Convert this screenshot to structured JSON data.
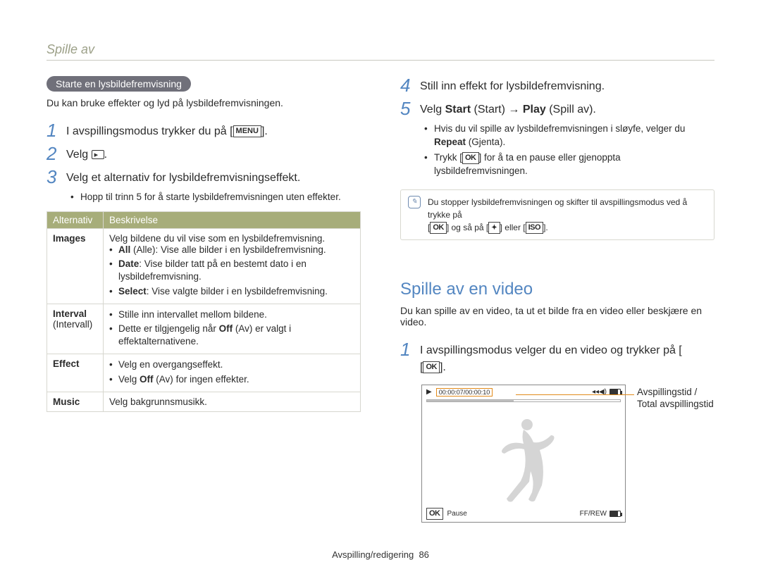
{
  "header": {
    "section": "Spille av"
  },
  "left": {
    "pill": "Starte en lysbildefremvisning",
    "intro": "Du kan bruke effekter og lyd på lysbildefremvisningen.",
    "step1_pre": "I avspillingsmodus trykker du på [",
    "step1_key": "MENU",
    "step1_post": "].",
    "step2": "Velg ",
    "step3": "Velg et alternativ for lysbildefremvisningseffekt.",
    "step3_bullet": "Hopp til trinn 5 for å starte lysbildefremvisningen uten effekter.",
    "table": {
      "h1": "Alternativ",
      "h2": "Beskrivelse",
      "rows": [
        {
          "opt": "Images",
          "desc_intro": "Velg bildene du vil vise som en lysbildefremvisning.",
          "items": [
            {
              "b": "All",
              "paren": "(Alle)",
              "rest": ": Vise alle bilder i en lysbildefremvisning."
            },
            {
              "b": "Date",
              "paren": "",
              "rest": ": Vise bilder tatt på en bestemt dato i en lysbildefremvisning."
            },
            {
              "b": "Select",
              "paren": "",
              "rest": ": Vise valgte bilder i en lysbildefremvisning."
            }
          ]
        },
        {
          "opt": "Interval",
          "opt_paren": "(Intervall)",
          "items": [
            {
              "rest": "Stille inn intervallet mellom bildene."
            },
            {
              "rest": "Dette er tilgjengelig når ",
              "b": "Off",
              "paren": "(Av)",
              "rest2": " er valgt i effektalternativene."
            }
          ]
        },
        {
          "opt": "Effect",
          "items": [
            {
              "rest": "Velg en overgangseffekt."
            },
            {
              "rest": "Velg ",
              "b": "Off",
              "paren": "(Av)",
              "rest2": " for ingen effekter."
            }
          ]
        },
        {
          "opt": "Music",
          "desc_intro": "Velg bakgrunnsmusikk."
        }
      ]
    }
  },
  "right": {
    "step4": "Still inn effekt for lysbildefremvisning.",
    "step5_a": "Velg ",
    "step5_b_start": "Start",
    "step5_paren_start": " (Start) → ",
    "step5_b_play": "Play",
    "step5_paren_play": " (Spill av).",
    "step5_bullets": [
      {
        "pre": "Hvis du vil spille av lysbildefremvisningen i sløyfe, velger du ",
        "b": "Repeat",
        "paren": " (Gjenta)."
      },
      {
        "pre": "Trykk [",
        "key": "OK",
        "post": "] for å ta en pause eller gjenoppta lysbildefremvisningen."
      }
    ],
    "note_a": "Du stopper lysbildefremvisningen og skifter til avspillingsmodus ved å trykke på",
    "note_b_pre": "[",
    "note_b_mid": "] og så på [",
    "note_b_or": "] eller [",
    "note_b_end": "].",
    "h2": "Spille av en video",
    "intro2": "Du kan spille av en video, ta ut et bilde fra en video eller beskjære en video.",
    "vstep1_pre": "I avspillingsmodus velger du en video og trykker på [",
    "vstep1_key": "OK",
    "vstep1_post": "].",
    "video": {
      "time": "00:00:07/00:00:10",
      "pause": "Pause",
      "ffrew": "FF/REW"
    },
    "leader": "Avspillingstid /",
    "leader2": "Total avspillingstid"
  },
  "footer": {
    "section": "Avspilling/redigering",
    "page": "86"
  }
}
